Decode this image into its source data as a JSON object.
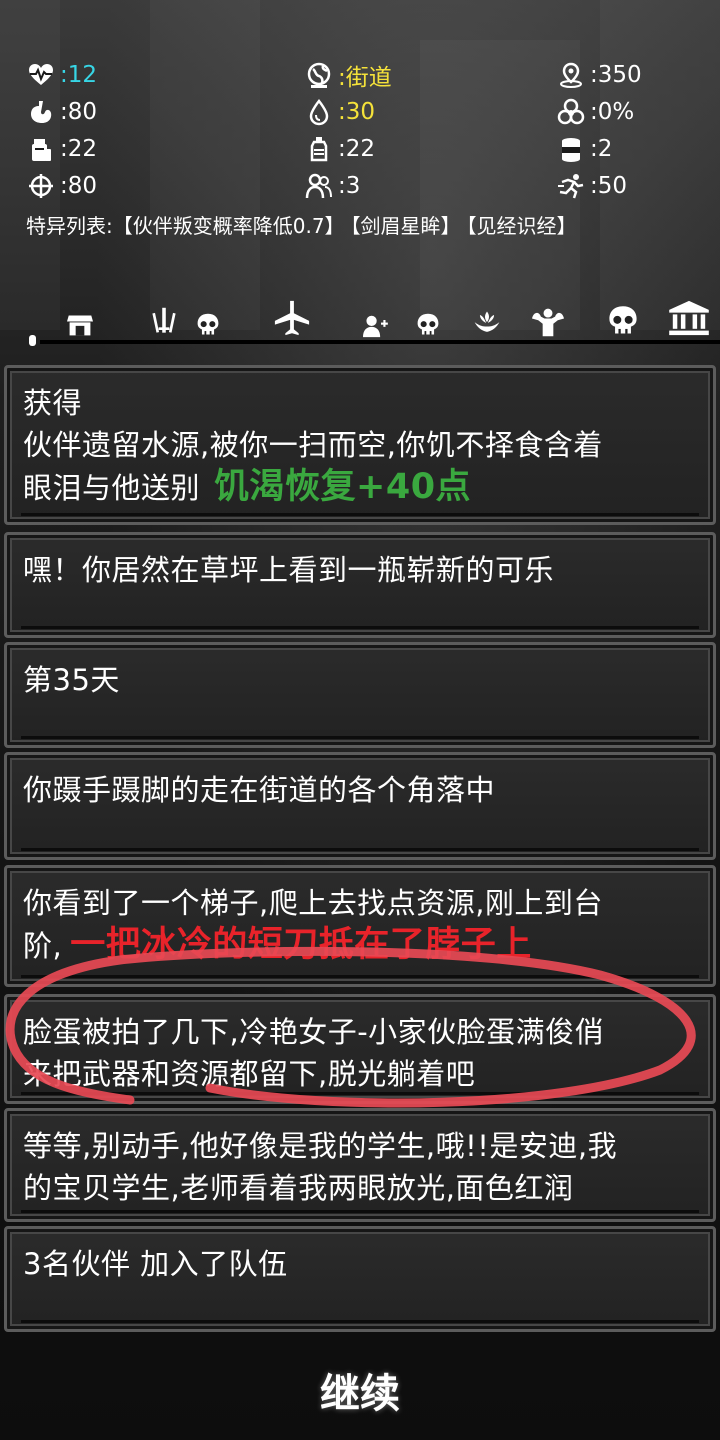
{
  "stats": [
    {
      "icon": "heartbeat-icon",
      "value": ":12",
      "color": "#37d6e6"
    },
    {
      "icon": "globe-location-icon",
      "value": ":街道",
      "color": "#f5e23a"
    },
    {
      "icon": "map-pin-icon",
      "value": ":350",
      "color": "#ffffff"
    },
    {
      "icon": "stomach-icon",
      "value": ":80",
      "color": "#ffffff"
    },
    {
      "icon": "water-drop-icon",
      "value": ":30",
      "color": "#f5e23a"
    },
    {
      "icon": "biohazard-icon",
      "value": ":0%",
      "color": "#ffffff"
    },
    {
      "icon": "food-can-icon",
      "value": ":22",
      "color": "#ffffff"
    },
    {
      "icon": "water-bottle-icon",
      "value": ":22",
      "color": "#ffffff"
    },
    {
      "icon": "canned-food-icon",
      "value": ":2",
      "color": "#ffffff"
    },
    {
      "icon": "crosshair-icon",
      "value": ":80",
      "color": "#ffffff"
    },
    {
      "icon": "companions-icon",
      "value": ":3",
      "color": "#ffffff"
    },
    {
      "icon": "running-icon",
      "value": ":50",
      "color": "#ffffff"
    }
  ],
  "traits": {
    "label": "特异列表:",
    "items": [
      "【伙伴叛变概率降低0.7】",
      "【剑眉星眸】",
      "【见经识经】"
    ]
  },
  "toolbar": [
    "shop-icon",
    "weapons-icon",
    "skull-icon",
    "airplane-icon",
    "add-companion-icon",
    "skull-icon",
    "lotus-hands-icon",
    "muscle-icon",
    "skull-icon",
    "bank-icon"
  ],
  "log": [
    {
      "lines": [
        "获得",
        "伙伴遗留水源,被你一扫而空,你饥不择食含着",
        "眼泪与他送别"
      ],
      "highlight": "饥渴恢复+40点",
      "highlight_color": "#3aa83f"
    },
    {
      "lines": [
        "嘿！你居然在草坪上看到一瓶崭新的可乐"
      ]
    },
    {
      "lines": [
        "第35天"
      ]
    },
    {
      "lines": [
        "你蹑手蹑脚的走在街道的各个角落中"
      ]
    },
    {
      "lines": [
        "你看到了一个梯子,爬上去找点资源,刚上到台",
        "阶,"
      ],
      "highlight": "一把冰冷的短刀抵在了脖子上",
      "highlight_color": "#e8232a"
    },
    {
      "lines": [
        "脸蛋被拍了几下,冷艳女子-小家伙脸蛋满俊俏",
        "来把武器和资源都留下,脱光躺着吧"
      ]
    },
    {
      "lines": [
        "等等,别动手,他好像是我的学生,哦!!是安迪,我",
        "的宝贝学生,老师看着我两眼放光,面色红润"
      ]
    },
    {
      "lines": [
        "3名伙伴 加入了队伍"
      ]
    }
  ],
  "continue_label": "继续"
}
